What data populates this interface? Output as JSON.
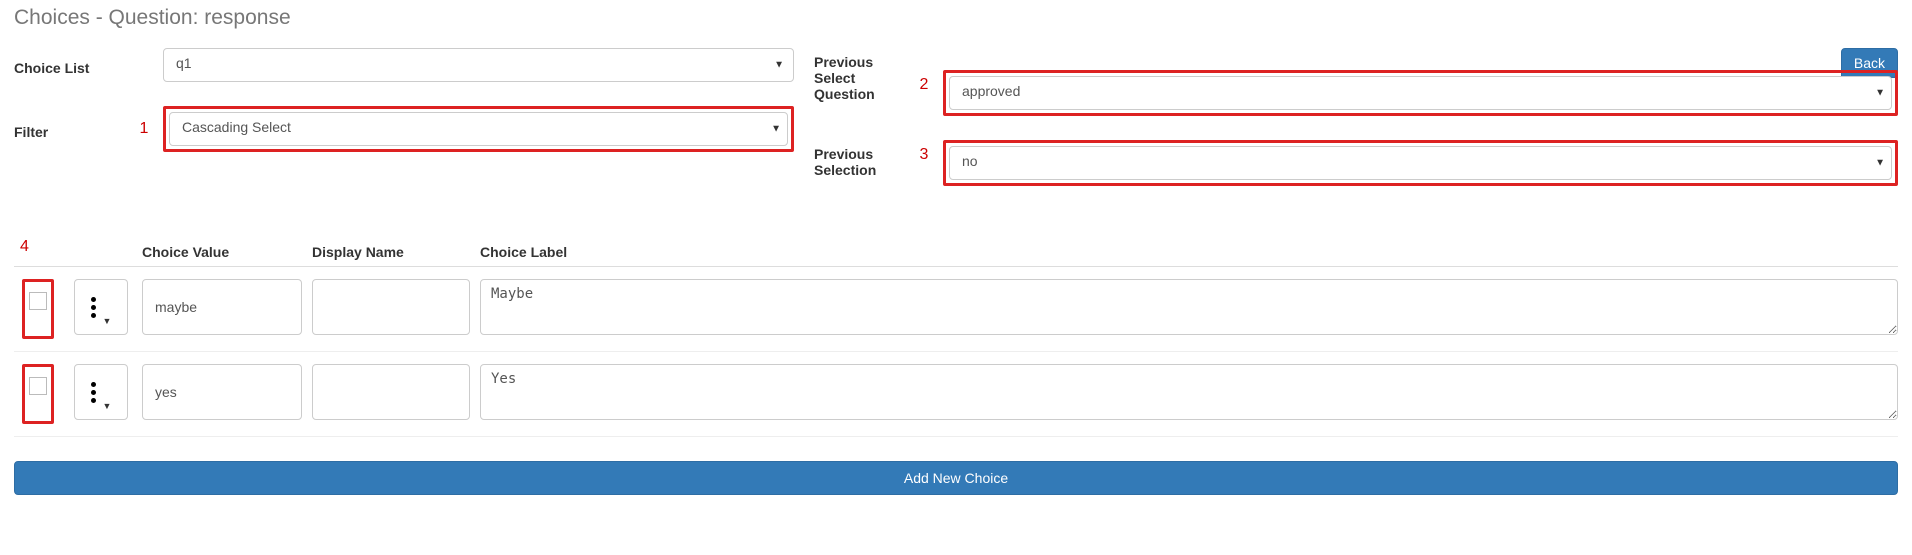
{
  "page_title": "Choices - Question: response",
  "labels": {
    "choice_list": "Choice List",
    "filter": "Filter",
    "prev_select_question": "Previous Select Question",
    "prev_selection": "Previous Selection"
  },
  "selects": {
    "choice_list": "q1",
    "filter": "Cascading Select",
    "prev_question": "approved",
    "prev_selection": "no"
  },
  "annotations": {
    "n1": "1",
    "n2": "2",
    "n3": "3",
    "n4": "4"
  },
  "buttons": {
    "back": "Back",
    "add": "Add New Choice"
  },
  "columns": {
    "choice_value": "Choice Value",
    "display_name": "Display Name",
    "choice_label": "Choice Label"
  },
  "rows": [
    {
      "value": "maybe",
      "display": "",
      "label": "Maybe"
    },
    {
      "value": "yes",
      "display": "",
      "label": "Yes"
    }
  ]
}
